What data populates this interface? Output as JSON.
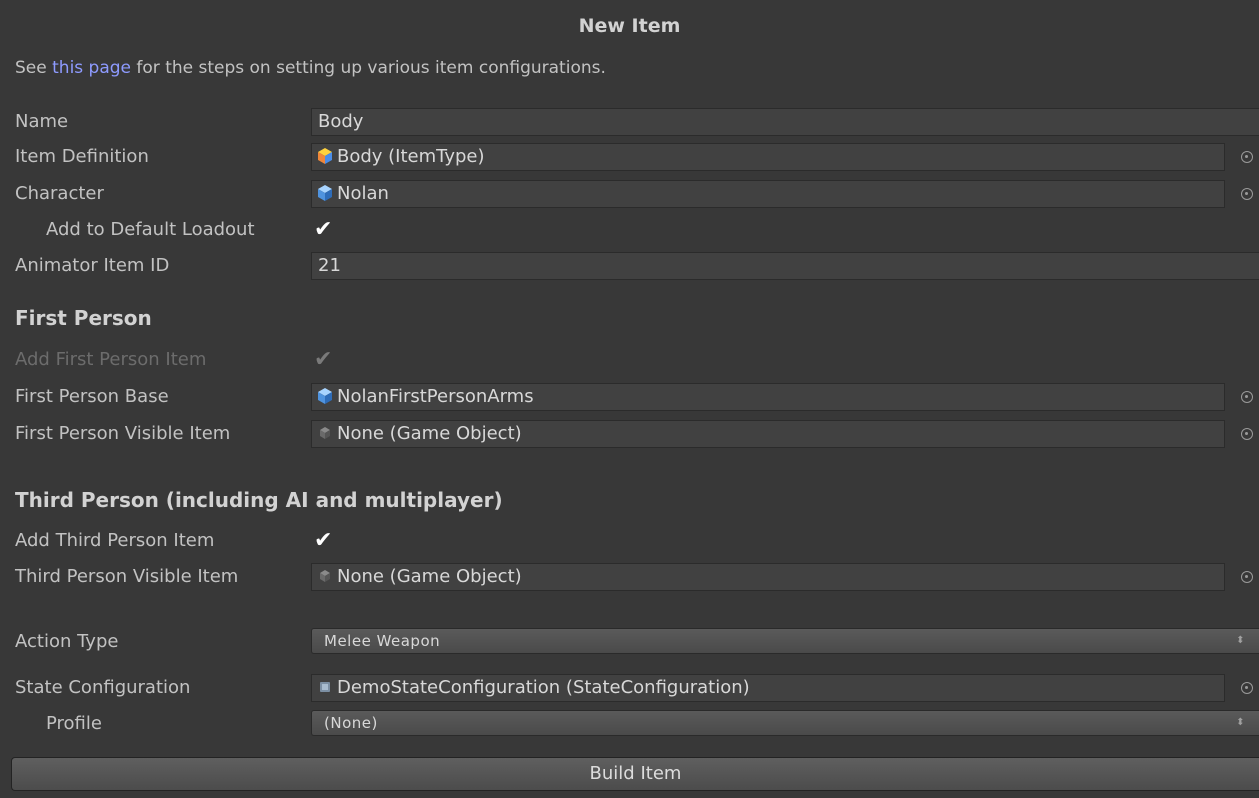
{
  "window": {
    "title": "New Item",
    "info_prefix": "See ",
    "info_link": "this page",
    "info_suffix": " for the steps on setting up various item configurations."
  },
  "fields": {
    "name": {
      "label": "Name",
      "value": "Body"
    },
    "item_definition": {
      "label": "Item Definition",
      "value": "Body (ItemType)",
      "icon": "itemtype-cube-icon"
    },
    "character": {
      "label": "Character",
      "value": "Nolan",
      "icon": "prefab-cube-icon"
    },
    "add_to_default_loadout": {
      "label": "Add to Default Loadout",
      "checked": true
    },
    "animator_item_id": {
      "label": "Animator Item ID",
      "value": "21"
    }
  },
  "first_person": {
    "heading": "First Person",
    "add_item": {
      "label": "Add First Person Item",
      "checked": true,
      "disabled": true
    },
    "base": {
      "label": "First Person Base",
      "value": "NolanFirstPersonArms",
      "icon": "prefab-cube-icon"
    },
    "visible_item": {
      "label": "First Person Visible Item",
      "value": "None (Game Object)",
      "icon": "gameobject-icon"
    }
  },
  "third_person": {
    "heading": "Third Person (including AI and multiplayer)",
    "add_item": {
      "label": "Add Third Person Item",
      "checked": true
    },
    "visible_item": {
      "label": "Third Person Visible Item",
      "value": "None (Game Object)",
      "icon": "gameobject-icon"
    }
  },
  "action_type": {
    "label": "Action Type",
    "selected": "Melee Weapon"
  },
  "state_configuration": {
    "label": "State Configuration",
    "value": "DemoStateConfiguration (StateConfiguration)",
    "icon": "scriptable-object-icon"
  },
  "profile": {
    "label": "Profile",
    "selected": "(None)"
  },
  "build_button": {
    "label": "Build Item"
  },
  "colors": {
    "background": "#383838",
    "link": "#8e9bff",
    "field": "#414141"
  }
}
